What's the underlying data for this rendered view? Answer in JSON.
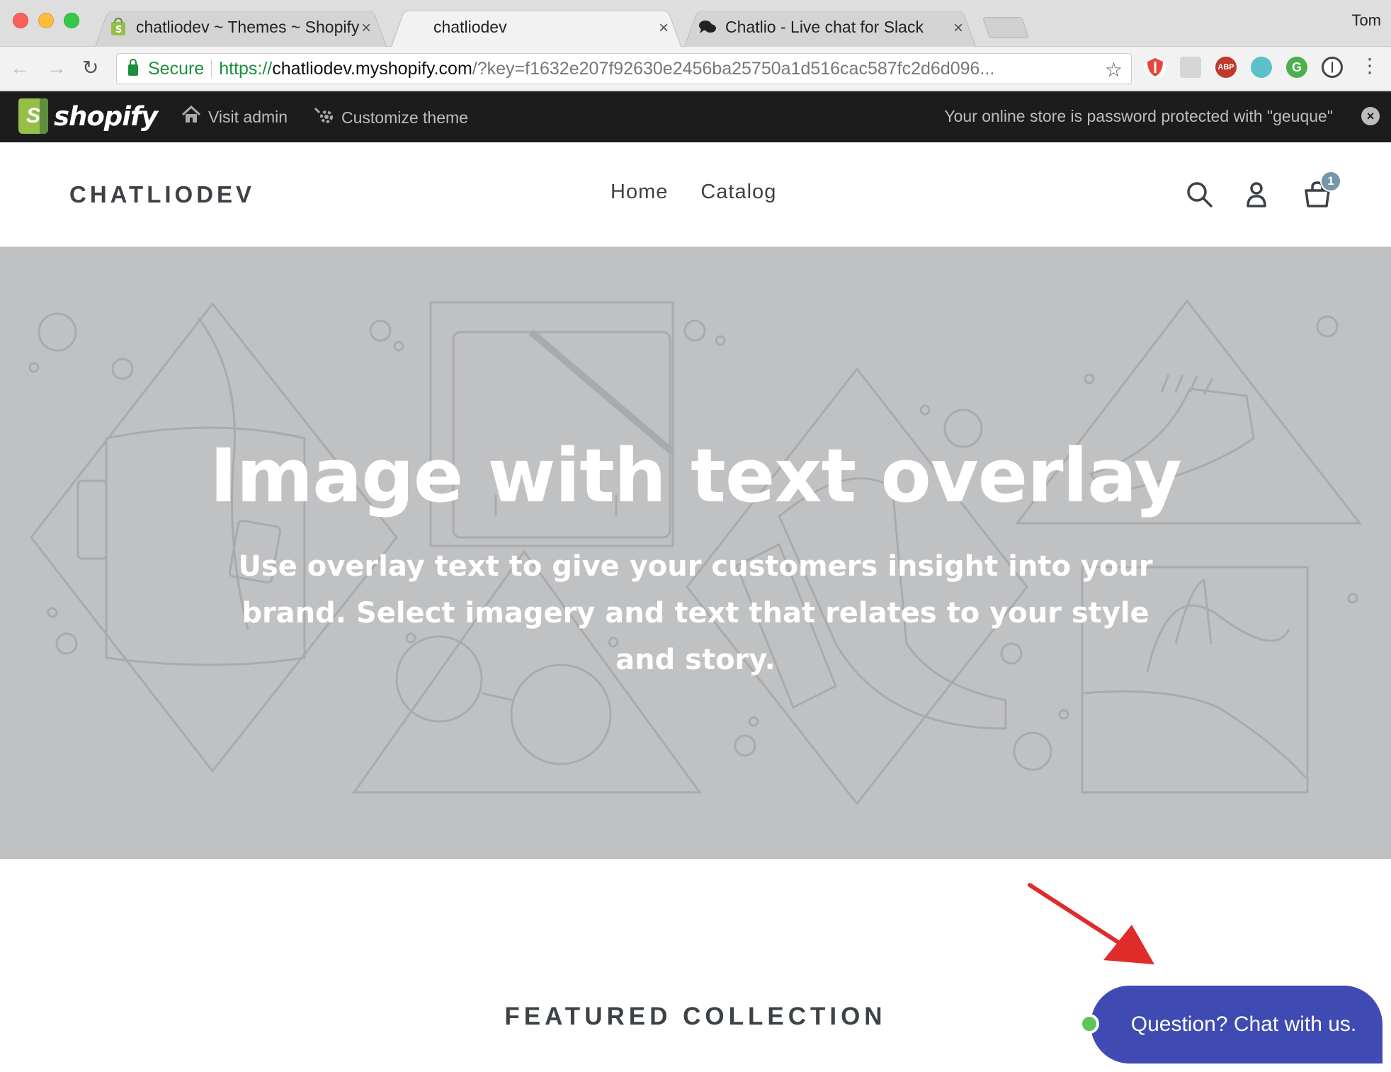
{
  "browser": {
    "tabs": [
      {
        "title": "chatliodev ~ Themes ~ Shopify",
        "close": "×",
        "favicon": "shopify-bag-icon"
      },
      {
        "title": "chatliodev",
        "close": "×",
        "favicon": "none"
      },
      {
        "title": "Chatlio - Live chat for Slack",
        "close": "×",
        "favicon": "chat-bubbles-icon"
      }
    ],
    "profile_name": "Tom",
    "secure_label": "Secure",
    "url_scheme": "https://",
    "url_host": "chatliodev.myshopify.com",
    "url_rest": "/?key=f1632e207f92630e2456ba25750a1d516cac587fc2d6d096...",
    "extensions": [
      {
        "icon": "shield-extension-icon",
        "label": "",
        "color": "#e8453c"
      },
      {
        "icon": "grid-extension-icon",
        "label": "",
        "color": "#cfcfcf"
      },
      {
        "icon": "adblock-icon",
        "label": "ABP",
        "color": "#c0392b"
      },
      {
        "icon": "teal-extension-icon",
        "label": "",
        "color": "#5bc0c8"
      },
      {
        "icon": "grammarly-icon",
        "label": "",
        "color": "#4caf50"
      },
      {
        "icon": "password-manager-icon",
        "label": "",
        "color": "#555555"
      }
    ]
  },
  "admin_bar": {
    "logo_text": "shopify",
    "visit_admin": "Visit admin",
    "customize_theme": "Customize theme",
    "password_notice": "Your online store is password protected with \"geuque\""
  },
  "store": {
    "name": "CHATLIODEV",
    "nav": [
      "Home",
      "Catalog"
    ],
    "cart_count": "1"
  },
  "hero": {
    "title": "Image with text overlay",
    "subtitle": "Use overlay text to give your customers insight into your brand. Select imagery and text that relates to your style and story."
  },
  "featured_title": "FEATURED COLLECTION",
  "chat": {
    "label": "Question? Chat with us.",
    "online_color": "#5dc65b",
    "button_color": "#3f4ab3"
  },
  "colors": {
    "shopify_green": "#95bf47",
    "arrow_red": "#e02b2b",
    "hero_bg": "#c0c1c3"
  }
}
